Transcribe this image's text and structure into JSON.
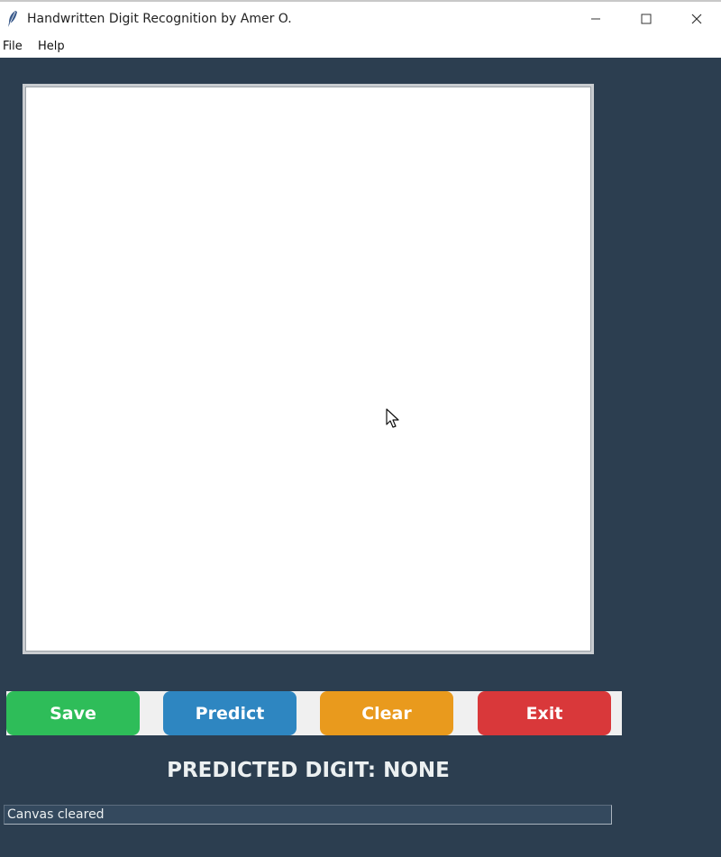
{
  "window": {
    "title": "Handwritten Digit Recognition by Amer O.",
    "app_icon": "feather-icon",
    "controls": {
      "minimize_icon": "minimize-icon",
      "maximize_icon": "maximize-icon",
      "close_icon": "close-icon"
    }
  },
  "menu": {
    "items": [
      {
        "label": "File"
      },
      {
        "label": "Help"
      }
    ]
  },
  "canvas": {
    "background": "#ffffff",
    "cursor_icon": "arrow-cursor-icon"
  },
  "buttons": {
    "save": {
      "label": "Save",
      "color": "#2ebd59"
    },
    "predict": {
      "label": "Predict",
      "color": "#2e86c1"
    },
    "clear": {
      "label": "Clear",
      "color": "#e99a1d"
    },
    "exit": {
      "label": "Exit",
      "color": "#d9383a"
    }
  },
  "result": {
    "prediction_text": "PREDICTED DIGIT: NONE"
  },
  "status": {
    "text": "Canvas cleared"
  },
  "colors": {
    "background": "#2c3e50",
    "text_light": "#ecf0f1"
  }
}
